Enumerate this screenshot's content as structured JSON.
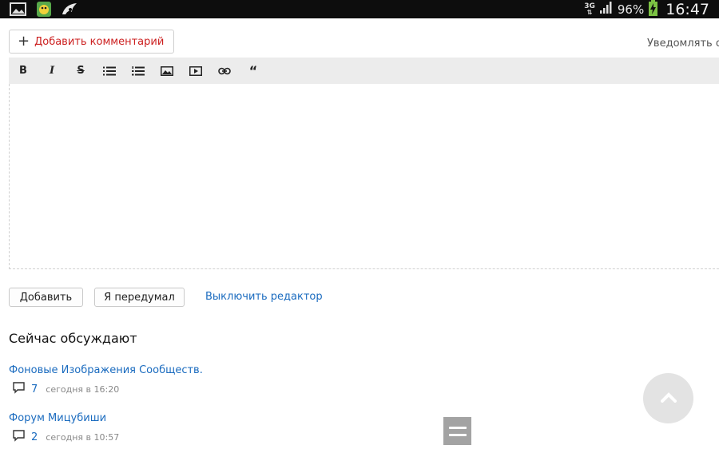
{
  "status_bar": {
    "icons": [
      "gallery-icon",
      "game-app-icon",
      "bird-app-icon"
    ],
    "network": "3G",
    "battery": "96%",
    "time": "16:47"
  },
  "comment": {
    "add_button_label": "Добавить комментарий",
    "notify_label": "Уведомлять о н"
  },
  "toolbar": {
    "bold": "B",
    "italic": "I",
    "strike": "S",
    "quote": "“"
  },
  "form": {
    "submit_label": "Добавить",
    "cancel_label": "Я передумал",
    "disable_editor_label": "Выключить редактор"
  },
  "discussion": {
    "title": "Сейчас обсуждают",
    "topics": [
      {
        "title": "Фоновые Изображения Сообществ.",
        "count": "7",
        "time": "сегодня в 16:20"
      },
      {
        "title": "Форум Мицубиши",
        "count": "2",
        "time": "сегодня в 10:57"
      }
    ]
  }
}
